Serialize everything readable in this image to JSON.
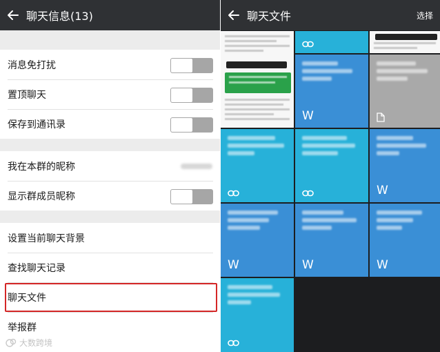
{
  "left": {
    "title": "聊天信息(13)",
    "toggles_section": [
      {
        "label": "消息免打扰"
      },
      {
        "label": "置顶聊天"
      },
      {
        "label": "保存到通讯录"
      }
    ],
    "member_section": [
      {
        "label": "我在本群的昵称"
      },
      {
        "label": "显示群成员昵称"
      }
    ],
    "actions_section": [
      {
        "label": "设置当前聊天背景"
      },
      {
        "label": "查找聊天记录"
      },
      {
        "label": "聊天文件"
      },
      {
        "label": "举报群"
      }
    ],
    "watermark": "大数跨境"
  },
  "right": {
    "title": "聊天文件",
    "select_label": "选择",
    "tiles": [
      {
        "kind": "doc"
      },
      {
        "kind": "link",
        "icon": "link-icon"
      },
      {
        "kind": "doc"
      },
      {
        "kind": "word",
        "icon": "word-icon",
        "letter": "W"
      },
      {
        "kind": "file",
        "icon": "file-icon"
      },
      {
        "kind": "link",
        "icon": "link-icon"
      },
      {
        "kind": "link",
        "icon": "link-icon"
      },
      {
        "kind": "word",
        "icon": "word-icon",
        "letter": "W"
      },
      {
        "kind": "word",
        "icon": "word-icon",
        "letter": "W"
      },
      {
        "kind": "word",
        "icon": "word-icon",
        "letter": "W"
      },
      {
        "kind": "word",
        "icon": "word-icon",
        "letter": "W"
      },
      {
        "kind": "link",
        "icon": "link-icon"
      }
    ]
  },
  "colors": {
    "topbar": "#2f3134",
    "tile_cyan": "#27b1d9",
    "tile_blue": "#3a8fd6",
    "tile_gray": "#a9a9a9",
    "highlight_border": "#d42626"
  }
}
